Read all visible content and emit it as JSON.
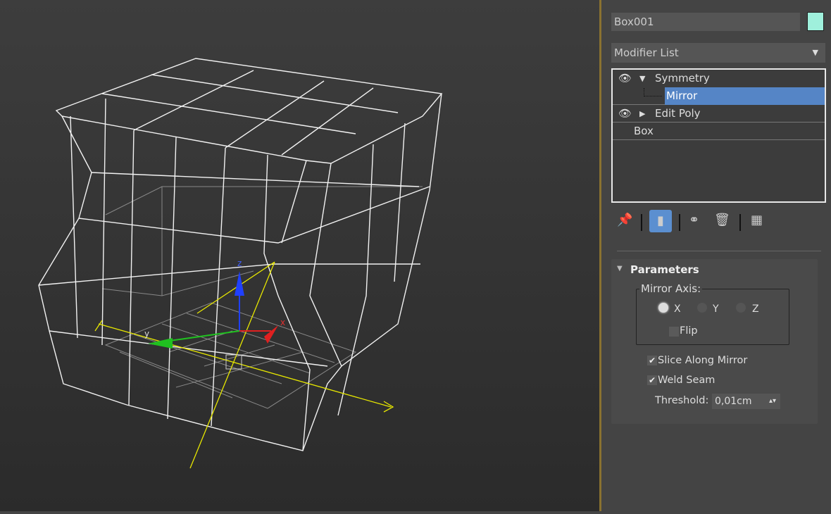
{
  "object": {
    "name": "Box001",
    "color": "#9ff0dc"
  },
  "modifier_list": {
    "label": "Modifier List"
  },
  "stack": {
    "items": [
      {
        "label": "Symmetry",
        "expanded": true,
        "visible": true,
        "sub": "Mirror"
      },
      {
        "label": "Edit Poly",
        "expanded": false,
        "visible": true
      },
      {
        "label": "Box"
      }
    ],
    "selected": "Mirror"
  },
  "toolbar": [
    "pin-stack-icon",
    "show-end-result-icon",
    "make-unique-icon",
    "remove-modifier-icon",
    "configure-modifier-sets-icon"
  ],
  "parameters": {
    "title": "Parameters",
    "mirror_axis_label": "Mirror Axis:",
    "axes": [
      "X",
      "Y",
      "Z"
    ],
    "selected_axis": "X",
    "flip_label": "Flip",
    "flip": false,
    "slice_label": "Slice Along Mirror",
    "slice": true,
    "weld_label": "Weld Seam",
    "weld": true,
    "threshold_label": "Threshold:",
    "threshold_value": "0,01cm"
  },
  "gizmo": {
    "x_label": "x",
    "y_label": "y",
    "z_label": "z"
  },
  "colors": {
    "accent": "#5585c6",
    "wire": "#ffffff",
    "mirror_gizmo": "#e8e800"
  }
}
